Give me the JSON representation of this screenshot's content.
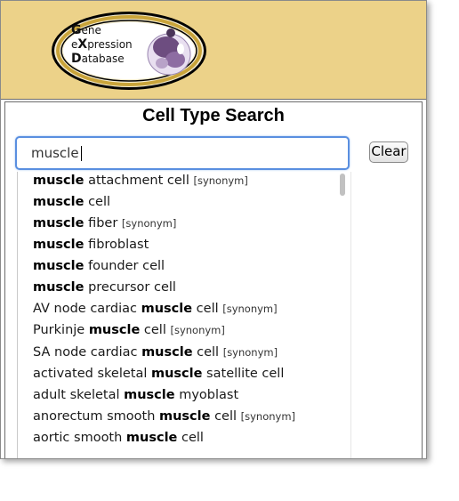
{
  "logo": {
    "line1_initial": "G",
    "line1_rest": "ene",
    "line2_pre": "e",
    "line2_initial": "X",
    "line2_rest": "pression",
    "line3_initial": "D",
    "line3_rest": "atabase"
  },
  "page_title": "Cell Type Search",
  "search": {
    "value": "muscle"
  },
  "clear_label": "Clear",
  "suggestions": [
    {
      "pre": "",
      "match": "muscle",
      "post": " attachment cell",
      "tag": "[synonym]"
    },
    {
      "pre": "",
      "match": "muscle",
      "post": " cell",
      "tag": ""
    },
    {
      "pre": "",
      "match": "muscle",
      "post": " fiber",
      "tag": "[synonym]"
    },
    {
      "pre": "",
      "match": "muscle",
      "post": " fibroblast",
      "tag": ""
    },
    {
      "pre": "",
      "match": "muscle",
      "post": " founder cell",
      "tag": ""
    },
    {
      "pre": "",
      "match": "muscle",
      "post": " precursor cell",
      "tag": ""
    },
    {
      "pre": "AV node cardiac ",
      "match": "muscle",
      "post": " cell",
      "tag": "[synonym]"
    },
    {
      "pre": "Purkinje ",
      "match": "muscle",
      "post": " cell",
      "tag": "[synonym]"
    },
    {
      "pre": "SA node cardiac ",
      "match": "muscle",
      "post": " cell",
      "tag": "[synonym]"
    },
    {
      "pre": "activated skeletal ",
      "match": "muscle",
      "post": " satellite cell",
      "tag": ""
    },
    {
      "pre": "adult skeletal ",
      "match": "muscle",
      "post": " myoblast",
      "tag": ""
    },
    {
      "pre": "anorectum smooth ",
      "match": "muscle",
      "post": " cell",
      "tag": "[synonym]"
    },
    {
      "pre": "aortic smooth ",
      "match": "muscle",
      "post": " cell",
      "tag": ""
    }
  ]
}
